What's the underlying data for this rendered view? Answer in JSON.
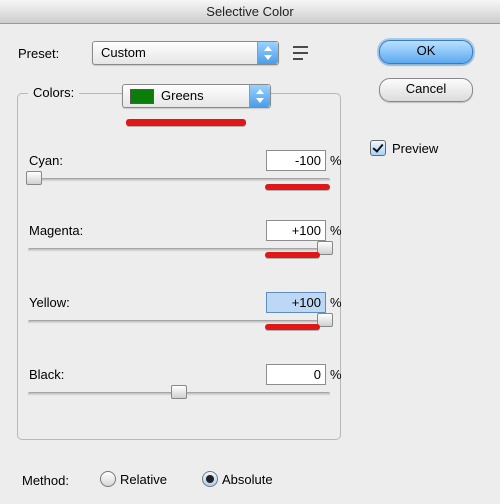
{
  "title": "Selective Color",
  "preset": {
    "label": "Preset:",
    "value": "Custom",
    "menu_icon": "preset-menu-icon"
  },
  "buttons": {
    "ok": "OK",
    "cancel": "Cancel"
  },
  "preview": {
    "label": "Preview",
    "checked": true
  },
  "colors": {
    "label": "Colors:",
    "value": "Greens",
    "swatch_hex": "#0a7d0a",
    "channels": {
      "cyan": {
        "label": "Cyan:",
        "value": "-100",
        "unit": "%"
      },
      "magenta": {
        "label": "Magenta:",
        "value": "+100",
        "unit": "%"
      },
      "yellow": {
        "label": "Yellow:",
        "value": "+100",
        "unit": "%"
      },
      "black": {
        "label": "Black:",
        "value": "0",
        "unit": "%"
      }
    }
  },
  "method": {
    "label": "Method:",
    "relative_label": "Relative",
    "absolute_label": "Absolute",
    "selected": "absolute"
  }
}
